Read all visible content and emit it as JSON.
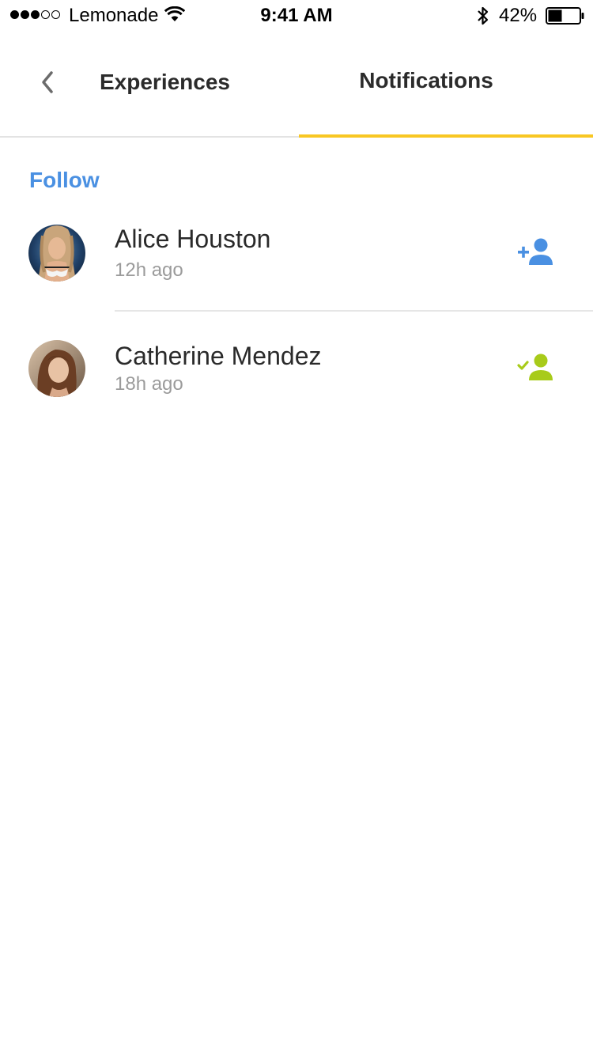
{
  "status_bar": {
    "carrier": "Lemonade",
    "time": "9:41 AM",
    "battery": "42%",
    "signal_bars_filled": 3,
    "signal_bars_total": 5,
    "battery_level": 0.42
  },
  "header": {
    "back_icon": "chevron-left-icon",
    "tabs": [
      {
        "label": "Experiences",
        "active": false
      },
      {
        "label": "Notifications",
        "active": true
      }
    ],
    "indicator_color": "#f8c723"
  },
  "section": {
    "title": "Follow",
    "title_color": "#4a90e2"
  },
  "notifications": [
    {
      "name": "Alice Houston",
      "time": "12h ago",
      "action_icon": "add-person-icon",
      "action_color": "#4a90e2",
      "following": false
    },
    {
      "name": "Catherine Mendez",
      "time": "18h ago",
      "action_icon": "person-check-icon",
      "action_color": "#a8cb1a",
      "following": true
    }
  ]
}
